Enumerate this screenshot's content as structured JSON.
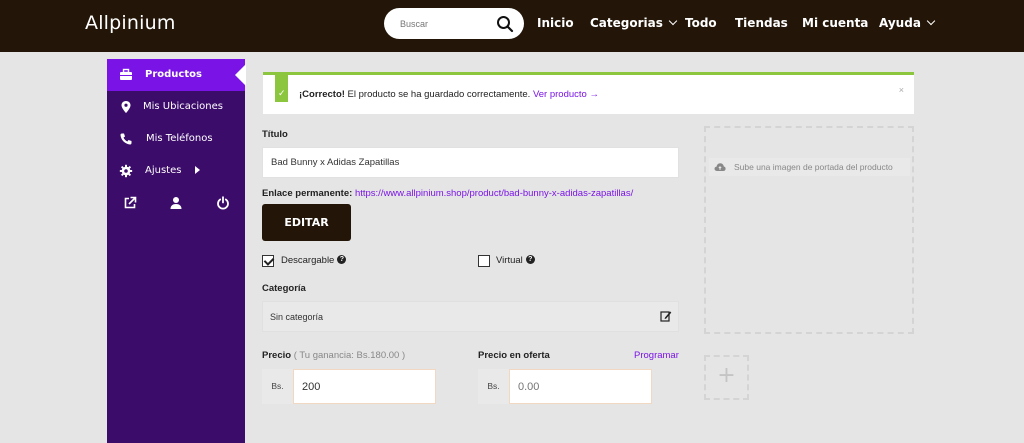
{
  "header": {
    "logo": "Allpinium",
    "search_placeholder": "Buscar",
    "nav": [
      {
        "label": "Inicio",
        "dropdown": false
      },
      {
        "label": "Categorias",
        "dropdown": true
      },
      {
        "label": "Todo",
        "dropdown": false
      },
      {
        "label": "Tiendas",
        "dropdown": false
      },
      {
        "label": "Mi cuenta",
        "dropdown": false
      },
      {
        "label": "Ayuda",
        "dropdown": true
      }
    ]
  },
  "sidebar": {
    "items": [
      {
        "label": "Productos",
        "icon": "briefcase-icon",
        "active": true
      },
      {
        "label": "Mis Ubicaciones",
        "icon": "map-pin-icon"
      },
      {
        "label": "Mis Teléfonos",
        "icon": "phone-icon"
      },
      {
        "label": "Ajustes",
        "icon": "gear-icon",
        "submenu": true
      }
    ],
    "tools": [
      "external-link-icon",
      "user-icon",
      "power-icon"
    ]
  },
  "alert": {
    "strong": "¡Correcto!",
    "text": " El producto se ha guardado correctamente. ",
    "link": "Ver producto →",
    "close": "×"
  },
  "form": {
    "title_label": "Título",
    "title_value": "Bad Bunny x Adidas Zapatillas",
    "permalink_label": "Enlace permanente:",
    "permalink_url": "https://www.allpinium.shop/product/bad-bunny-x-adidas-zapatillas/",
    "edit_button": "EDITAR",
    "downloadable_label": "Descargable",
    "downloadable_checked": true,
    "virtual_label": "Virtual",
    "virtual_checked": false,
    "help_glyph": "?",
    "category_label": "Categoría",
    "category_value": "Sin categoría",
    "price_label": "Precio",
    "price_hint": "( Tu ganancia: Bs.180.00 )",
    "currency": "Bs.",
    "price_value": "200",
    "sale_label": "Precio en oferta",
    "sale_schedule": "Programar",
    "sale_placeholder": "0.00"
  },
  "media": {
    "cover_upload": "Sube una imagen de portada del producto",
    "add_glyph": "+"
  },
  "colors": {
    "header_bg": "#231608",
    "sidebar_bg": "#3c0c6b",
    "accent": "#7a13e6",
    "success": "#8cc63f"
  }
}
